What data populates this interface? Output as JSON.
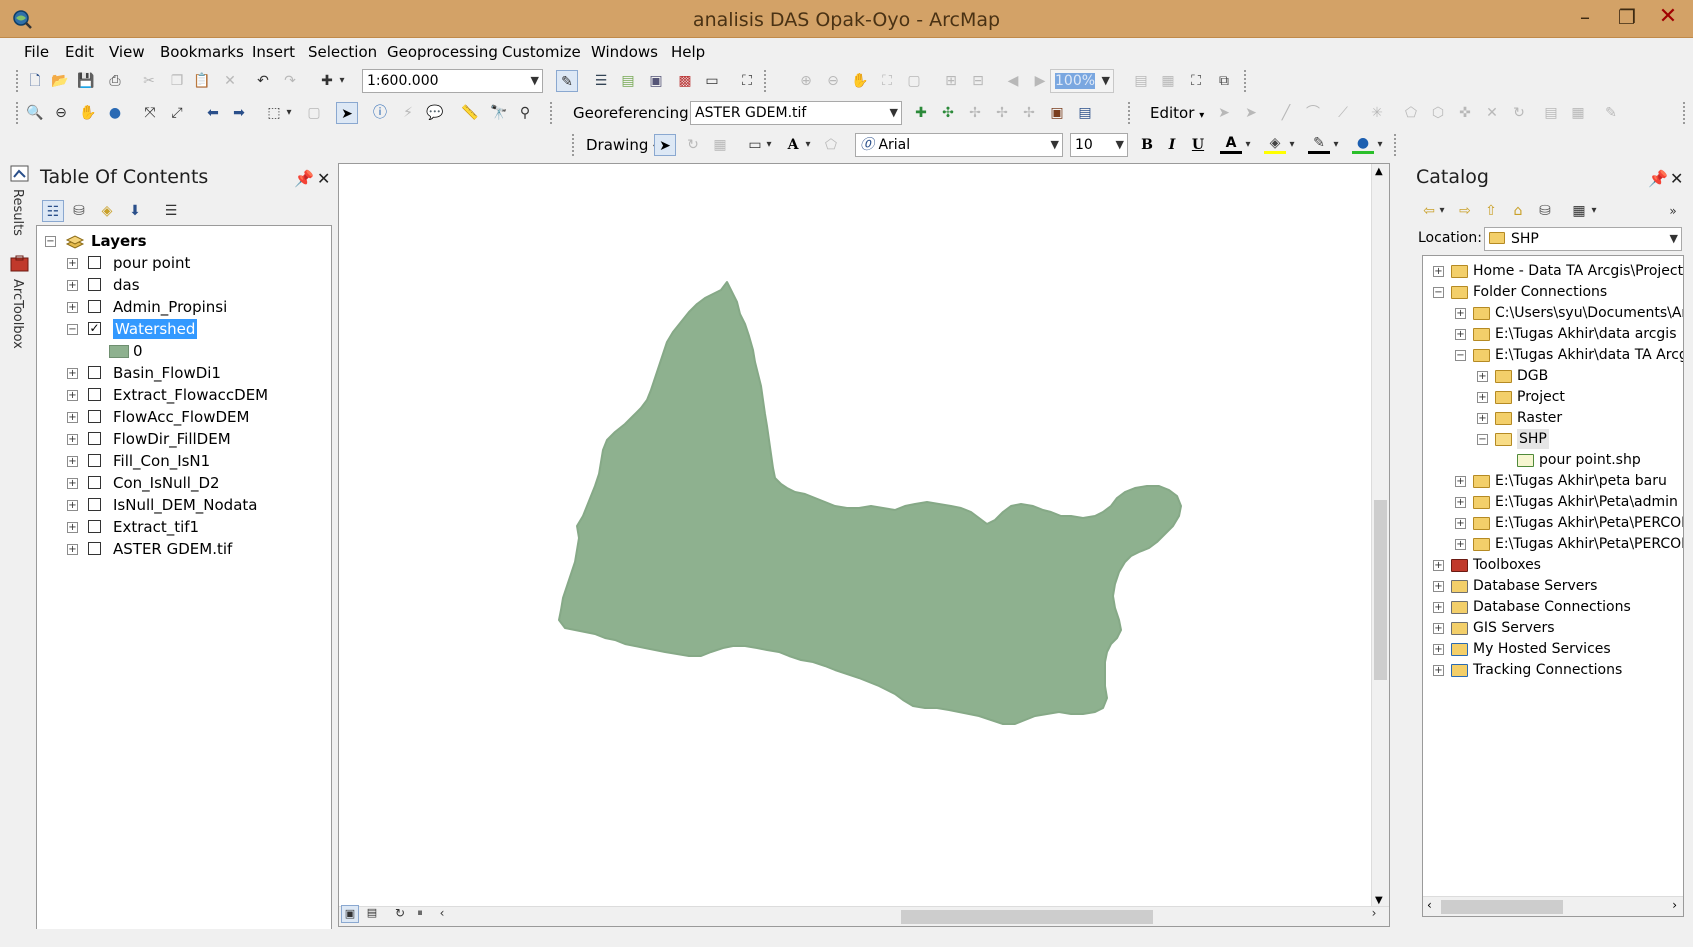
{
  "window": {
    "title": "analisis DAS Opak-Oyo - ArcMap",
    "minimize": "–",
    "restore": "❐",
    "close": "✕"
  },
  "menu": [
    "File",
    "Edit",
    "View",
    "Bookmarks",
    "Insert",
    "Selection",
    "Geoprocessing",
    "Customize",
    "Windows",
    "Help"
  ],
  "toolbar": {
    "scale": "1:600.000",
    "georeferencing_label": "Georeferencing",
    "georef_layer": "ASTER GDEM.tif",
    "editor_label": "Editor",
    "drawing_label": "Drawing",
    "font_name": "Arial",
    "font_size": "10",
    "bold": "B",
    "italic": "I",
    "underline": "U",
    "zoom_pct": "100%"
  },
  "sidetabs": [
    "Results",
    "ArcToolbox"
  ],
  "toc": {
    "title": "Table Of Contents",
    "root": "Layers",
    "layers": [
      {
        "name": "pour point",
        "checked": false,
        "expanded": false
      },
      {
        "name": "das",
        "checked": false,
        "expanded": false
      },
      {
        "name": "Admin_Propinsi",
        "checked": false,
        "expanded": false
      },
      {
        "name": "Watershed",
        "checked": true,
        "expanded": true,
        "selected": true,
        "legend": "0",
        "legend_color": "#8eb18f"
      },
      {
        "name": "Basin_FlowDi1",
        "checked": false,
        "expanded": false
      },
      {
        "name": "Extract_FlowaccDEM",
        "checked": false,
        "expanded": false
      },
      {
        "name": "FlowAcc_FlowDEM",
        "checked": false,
        "expanded": false
      },
      {
        "name": "FlowDir_FillDEM",
        "checked": false,
        "expanded": false
      },
      {
        "name": "Fill_Con_IsN1",
        "checked": false,
        "expanded": false
      },
      {
        "name": "Con_IsNull_D2",
        "checked": false,
        "expanded": false
      },
      {
        "name": "IsNull_DEM_Nodata",
        "checked": false,
        "expanded": false
      },
      {
        "name": "Extract_tif1",
        "checked": false,
        "expanded": false
      },
      {
        "name": "ASTER GDEM.tif",
        "checked": false,
        "expanded": false
      }
    ]
  },
  "map": {
    "watershed_color": "#8eb18f"
  },
  "catalog": {
    "title": "Catalog",
    "location_label": "Location:",
    "location_value": "SHP",
    "items": [
      {
        "label": "Home - Data TA Arcgis\\Project",
        "level": 0,
        "exp": "+",
        "icon": "home-folder-icon"
      },
      {
        "label": "Folder Connections",
        "level": 0,
        "exp": "−",
        "icon": "folder-connections-icon"
      },
      {
        "label": "C:\\Users\\syu\\Documents\\Arc",
        "level": 1,
        "exp": "+",
        "icon": "folder-icon"
      },
      {
        "label": "E:\\Tugas Akhir\\data arcgis",
        "level": 1,
        "exp": "+",
        "icon": "folder-icon"
      },
      {
        "label": "E:\\Tugas Akhir\\data TA Arcgi",
        "level": 1,
        "exp": "−",
        "icon": "folder-icon"
      },
      {
        "label": "DGB",
        "level": 2,
        "exp": "+",
        "icon": "folder-icon"
      },
      {
        "label": "Project",
        "level": 2,
        "exp": "+",
        "icon": "folder-icon"
      },
      {
        "label": "Raster",
        "level": 2,
        "exp": "+",
        "icon": "folder-icon"
      },
      {
        "label": "SHP",
        "level": 2,
        "exp": "−",
        "icon": "folder-open-icon",
        "highlight": true
      },
      {
        "label": "pour point.shp",
        "level": 3,
        "exp": "",
        "icon": "point-shapefile-icon"
      },
      {
        "label": "E:\\Tugas Akhir\\peta baru",
        "level": 1,
        "exp": "+",
        "icon": "folder-icon"
      },
      {
        "label": "E:\\Tugas Akhir\\Peta\\admin k",
        "level": 1,
        "exp": "+",
        "icon": "folder-icon"
      },
      {
        "label": "E:\\Tugas Akhir\\Peta\\PERCOB",
        "level": 1,
        "exp": "+",
        "icon": "folder-icon"
      },
      {
        "label": "E:\\Tugas Akhir\\Peta\\PERCOB",
        "level": 1,
        "exp": "+",
        "icon": "folder-icon"
      },
      {
        "label": "Toolboxes",
        "level": 0,
        "exp": "+",
        "icon": "toolbox-icon"
      },
      {
        "label": "Database Servers",
        "level": 0,
        "exp": "+",
        "icon": "database-server-icon"
      },
      {
        "label": "Database Connections",
        "level": 0,
        "exp": "+",
        "icon": "database-connections-icon"
      },
      {
        "label": "GIS Servers",
        "level": 0,
        "exp": "+",
        "icon": "gis-server-icon"
      },
      {
        "label": "My Hosted Services",
        "level": 0,
        "exp": "+",
        "icon": "hosted-services-icon"
      },
      {
        "label": "Tracking Connections",
        "level": 0,
        "exp": "+",
        "icon": "tracking-connections-icon"
      }
    ]
  }
}
